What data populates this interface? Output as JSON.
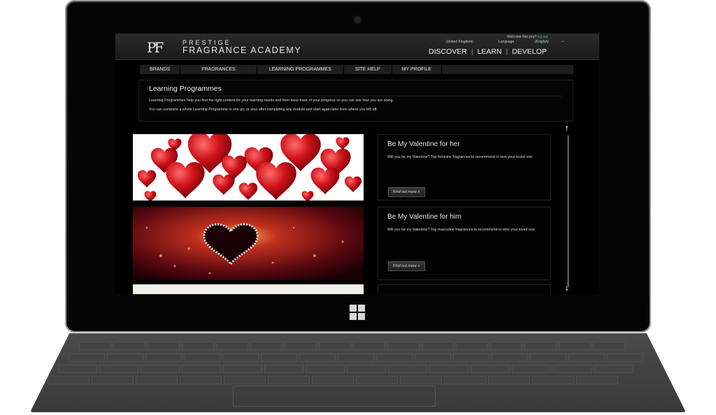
{
  "header": {
    "brand_line1": "PRESTIGE",
    "brand_line2": "FRAGRANCE ACADEMY",
    "welcome": "Welcome Not you?",
    "logout": "log out",
    "region": "(United Kingdom)",
    "language_label": "Language",
    "language_value": "(English)",
    "main_nav": [
      "DISCOVER",
      "LEARN",
      "DEVELOP"
    ]
  },
  "nav": [
    "BRANDS",
    "FRAGRANCES",
    "LEARNING PROGRAMMES",
    "SITE HELP",
    "MY PROFILE"
  ],
  "intro": {
    "title": "Learning Programmes",
    "p1": "Learning Programmes help you find the right content for your learning needs and then keep track of your progress so you can see how you are doing.",
    "p2": "You can complete a whole Learning Programme in one go, or stop after completing any module and start again later from where you left off."
  },
  "programmes": [
    {
      "title": "Be My Valentine for her",
      "description": "Will you be my Valentine? Top feminine fragrances to recommend to woo your loved one",
      "button": "Find out more »"
    },
    {
      "title": "Be My Valentine for him",
      "description": "Will you be my Valentine? Top masculine fragrances to recommend to woo your loved one",
      "button": "Find out more »"
    }
  ],
  "colors": {
    "link": "#3bb8c8",
    "heart_red": "#c8101a",
    "background": "#000000"
  }
}
